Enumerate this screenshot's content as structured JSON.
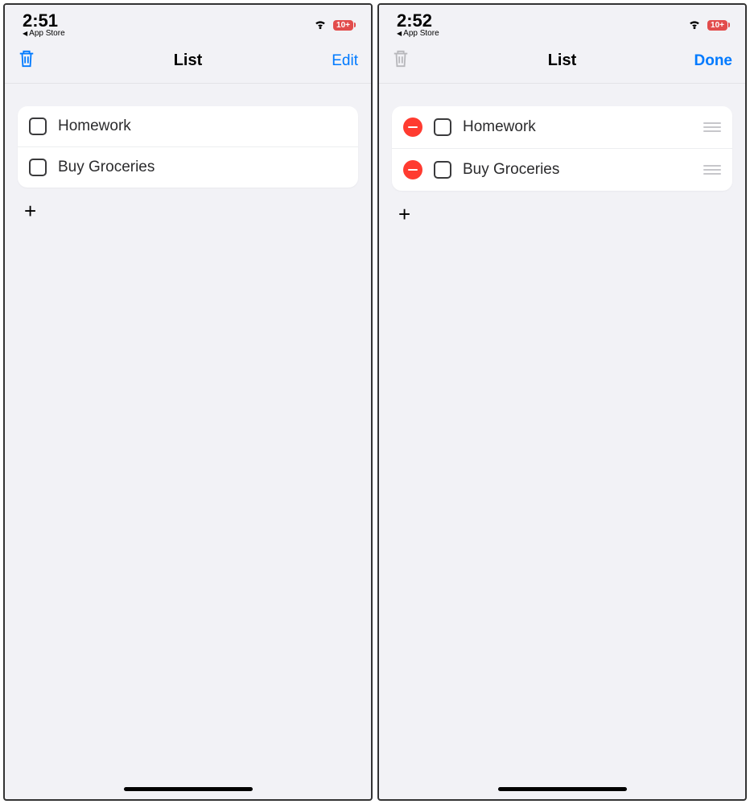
{
  "screens": [
    {
      "status": {
        "time": "2:51",
        "back_label": "App Store",
        "battery_text": "10+"
      },
      "nav": {
        "title": "List",
        "action_label": "Edit",
        "action_bold": false,
        "trash_enabled": true
      },
      "edit_mode": false,
      "items": [
        {
          "label": "Homework"
        },
        {
          "label": "Buy Groceries"
        }
      ]
    },
    {
      "status": {
        "time": "2:52",
        "back_label": "App Store",
        "battery_text": "10+"
      },
      "nav": {
        "title": "List",
        "action_label": "Done",
        "action_bold": true,
        "trash_enabled": false
      },
      "edit_mode": true,
      "items": [
        {
          "label": "Homework"
        },
        {
          "label": "Buy Groceries"
        }
      ]
    }
  ]
}
